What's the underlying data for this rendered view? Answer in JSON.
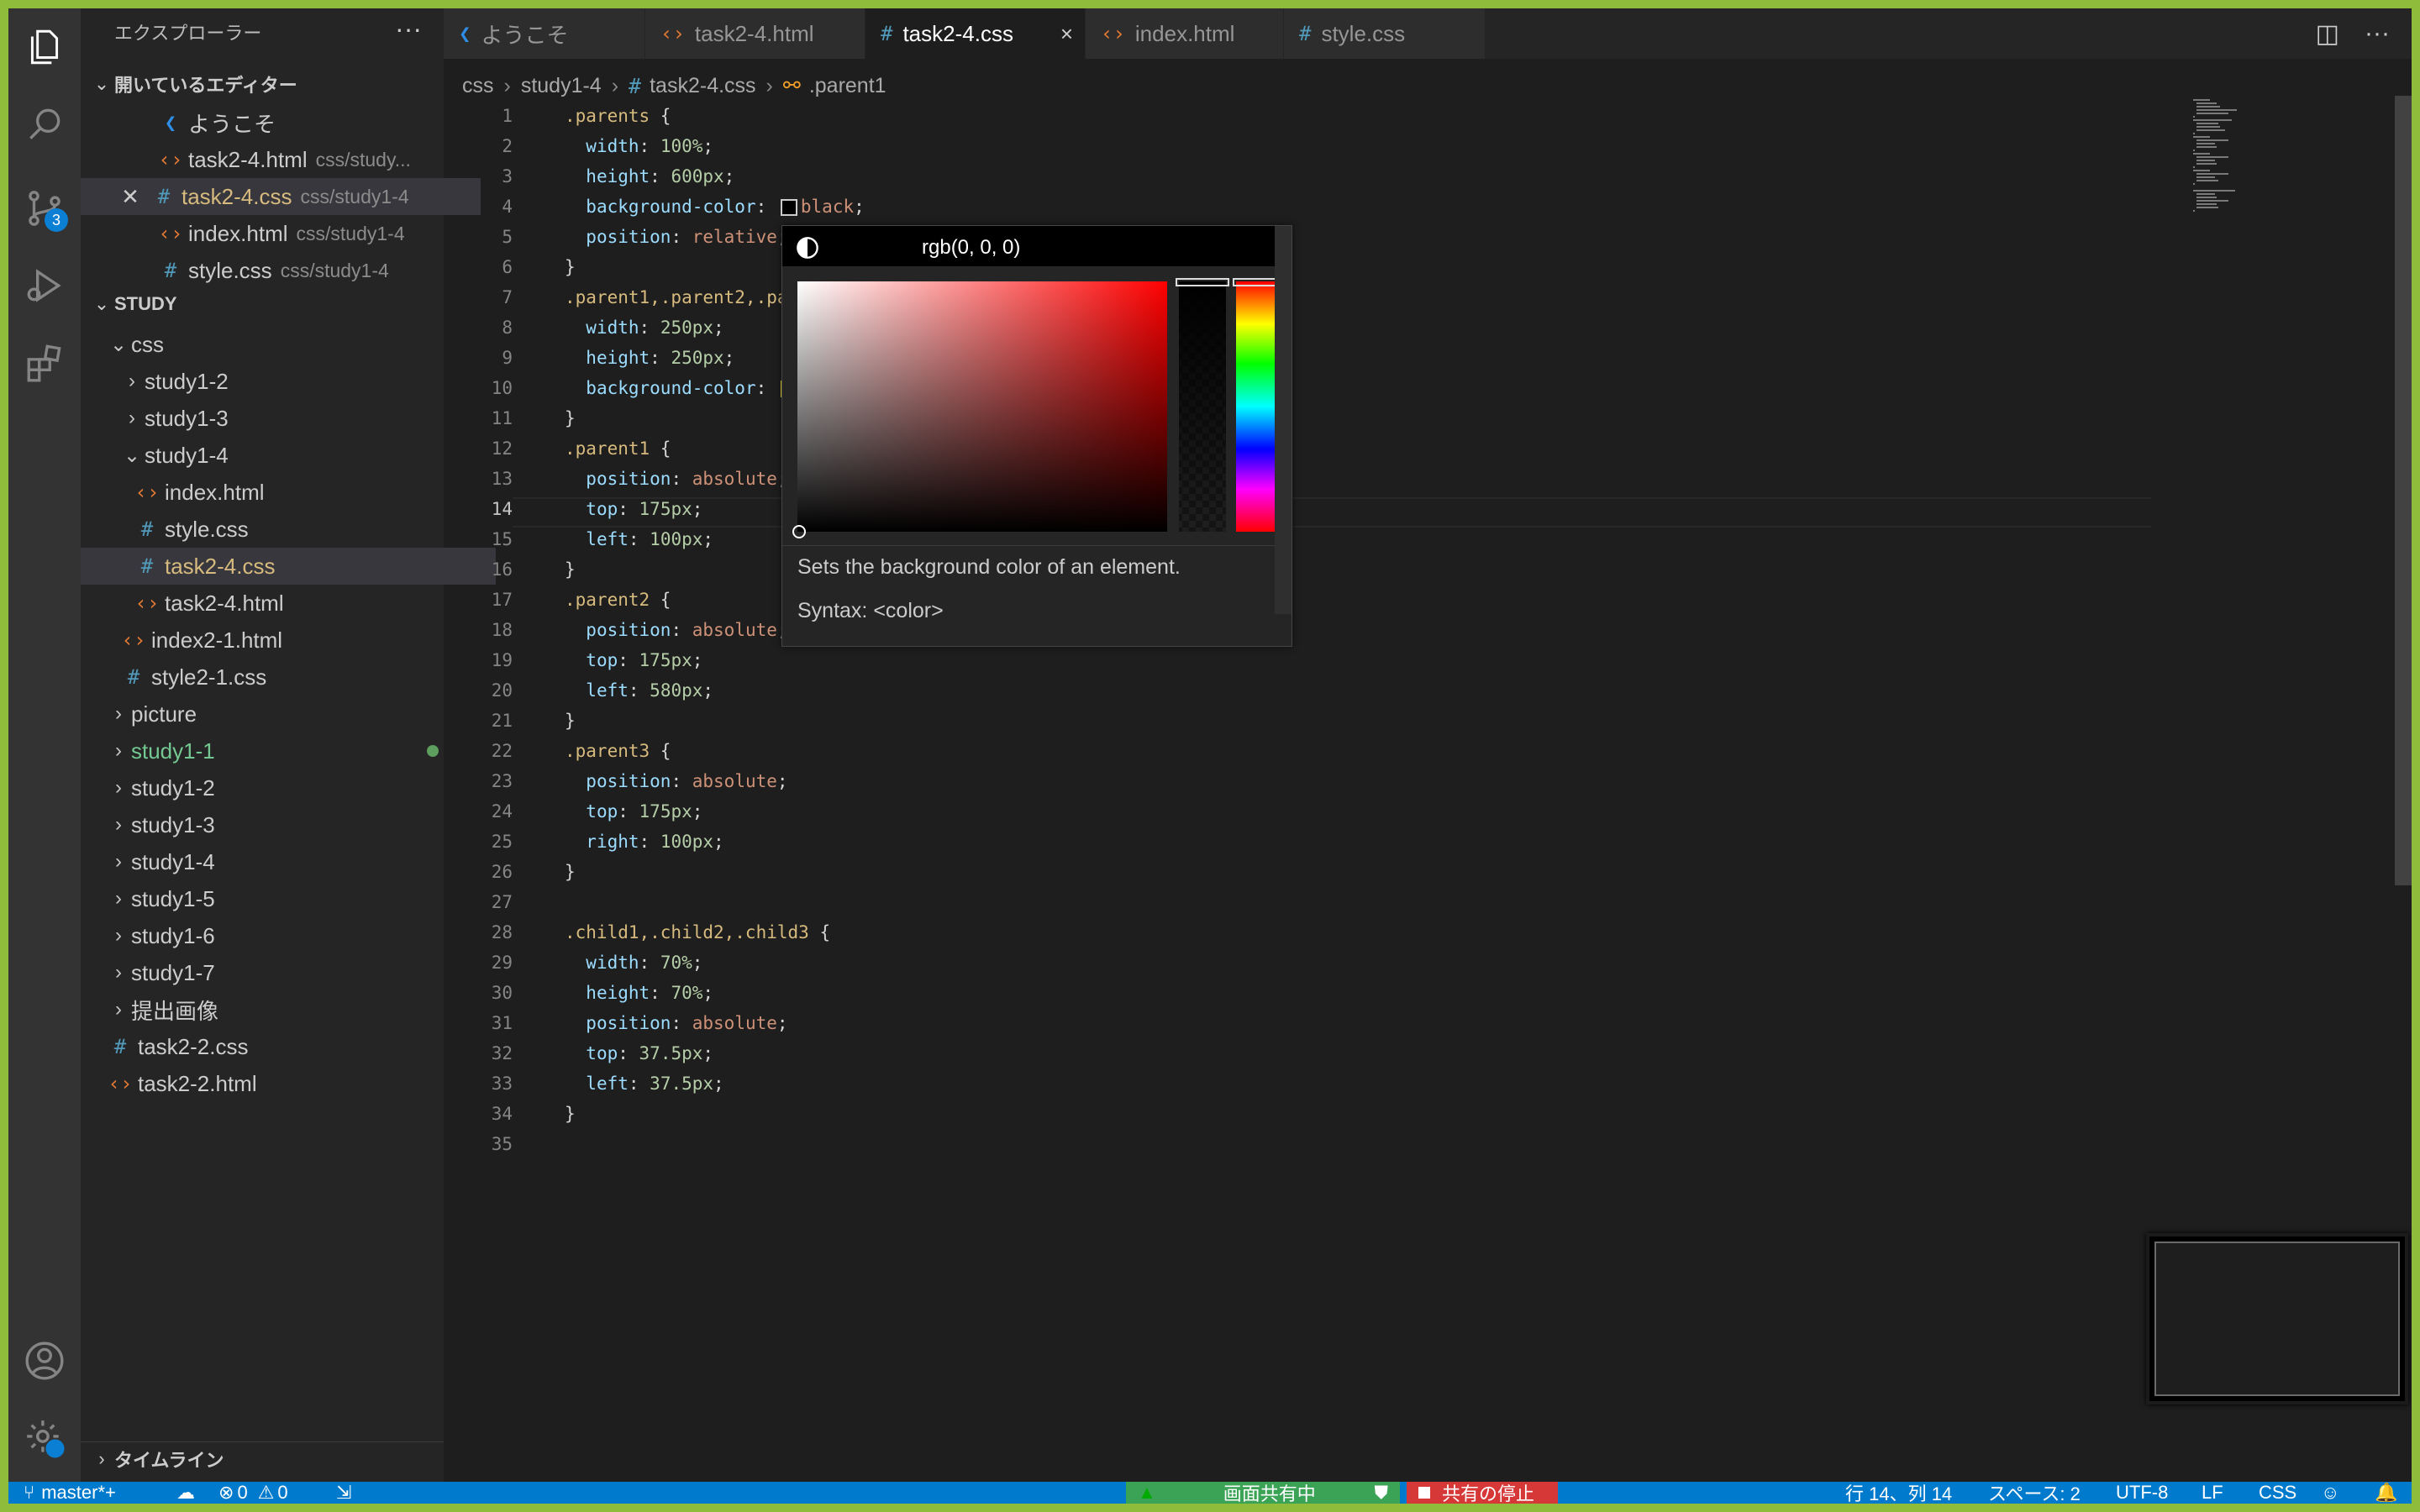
{
  "sidebar": {
    "title": "エクスプローラー",
    "more": "···",
    "open_editors": {
      "label": "開いているエディター",
      "items": [
        {
          "name": "ようこそ",
          "desc": ""
        },
        {
          "name": "task2-4.html",
          "desc": "css/study..."
        },
        {
          "name": "task2-4.css",
          "desc": "css/study1-4"
        },
        {
          "name": "index.html",
          "desc": "css/study1-4"
        },
        {
          "name": "style.css",
          "desc": "css/study1-4"
        }
      ]
    },
    "workspace": {
      "label": "STUDY",
      "tree": [
        "css",
        "study1-2",
        "study1-3",
        "study1-4",
        "index.html",
        "style.css",
        "task2-4.css",
        "task2-4.html",
        "index2-1.html",
        "style2-1.css",
        "picture",
        "study1-1",
        "study1-2",
        "study1-3",
        "study1-4",
        "study1-5",
        "study1-6",
        "study1-7",
        "提出画像",
        "task2-2.css",
        "task2-2.html"
      ]
    },
    "timeline": "タイムライン"
  },
  "activity": {
    "scm_badge": "3"
  },
  "tabs": [
    {
      "label": "ようこそ",
      "icon": "vscode-icon"
    },
    {
      "label": "task2-4.html",
      "icon": "html-icon"
    },
    {
      "label": "task2-4.css",
      "icon": "css-icon",
      "active": true
    },
    {
      "label": "index.html",
      "icon": "html-icon"
    },
    {
      "label": "style.css",
      "icon": "css-icon"
    }
  ],
  "tab_close": "×",
  "tab_actions": {
    "split": "◫",
    "more": "···"
  },
  "breadcrumb": [
    "css",
    "study1-4",
    "task2-4.css",
    ".parent1"
  ],
  "breadcrumb_sep": "›",
  "editor": {
    "current_line": 14,
    "lines": [
      ".parents {",
      "  width: 100%;",
      "  height: 600px;",
      "  background-color: black;",
      "  position: relative;",
      "}",
      ".parent1,.parent2,.pare",
      "  width: 250px;",
      "  height: 250px;",
      "  background-color: ",
      "}",
      ".parent1 {",
      "  position: absolute;",
      "  top: 175px;",
      "  left: 100px;",
      "}",
      ".parent2 {",
      "  position: absolute;",
      "  top: 175px;",
      "  left: 580px;",
      "}",
      ".parent3 {",
      "  position: absolute;",
      "  top: 175px;",
      "  right: 100px;",
      "}",
      "",
      ".child1,.child2,.child3 {",
      "  width: 70%;",
      "  height: 70%;",
      "  position: absolute;",
      "  top: 37.5px;",
      "  left: 37.5px;",
      "}",
      ""
    ]
  },
  "color_picker": {
    "value": "rgb(0, 0, 0)",
    "description": "Sets the background color of an element.",
    "syntax": "Syntax: <color>",
    "swatch_yellow": "#ffeb3b",
    "swatch_black": "#000000"
  },
  "status": {
    "branch": "master*+",
    "errors": "0",
    "warnings": "0",
    "sharing": "画面共有中",
    "stop_sharing": "共有の停止",
    "position": "行 14、列 14",
    "spaces": "スペース: 2",
    "encoding": "UTF-8",
    "eol": "LF",
    "language": "CSS"
  },
  "colors": {
    "accent": "#007acc",
    "frame": "#8fbc3b",
    "share_green": "#3ba356",
    "share_red": "#d63838"
  }
}
